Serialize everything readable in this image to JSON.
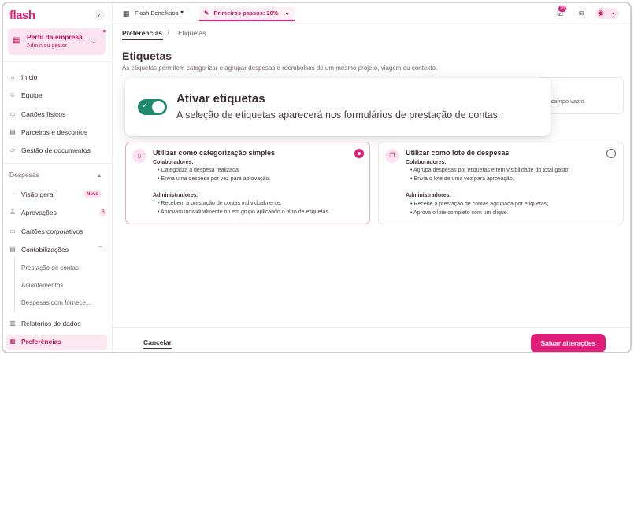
{
  "brand": {
    "logo": "flash",
    "collapse_glyph": "‹"
  },
  "profile": {
    "name": "Perfil da empresa",
    "role": "Admin ou gestor"
  },
  "nav": {
    "main": [
      {
        "label": "Início",
        "icon": "home-icon"
      },
      {
        "label": "Equipe",
        "icon": "users-icon"
      },
      {
        "label": "Cartões físicos",
        "icon": "card-icon"
      },
      {
        "label": "Parceiros e descontos",
        "icon": "store-icon"
      },
      {
        "label": "Gestão de documentos",
        "icon": "folder-icon"
      }
    ],
    "section_label": "Despesas",
    "expenses": [
      {
        "label": "Visão geral",
        "badge": "Novo"
      },
      {
        "label": "Aprovações",
        "badge": "3"
      },
      {
        "label": "Cartões corporativos"
      },
      {
        "label": "Contabilizações"
      }
    ],
    "sub": [
      "Prestação de contas",
      "Adiantamentos",
      "Despesas com fornece..."
    ],
    "bottom": [
      {
        "label": "Relatórios de dados"
      },
      {
        "label": "Preferências"
      }
    ]
  },
  "topbar": {
    "company": "Flash Benefícios",
    "first_steps": "Primeiros passos: 20%",
    "notification_count": "28"
  },
  "breadcrumb": {
    "parent": "Preferências",
    "current": "Etiquetas"
  },
  "page": {
    "title": "Etiquetas",
    "description": "As etiquetas permitem categorizar e agrupar despesas e reembolsos de um mesmo projeto, viagem ou contexto.",
    "behind_text": "m o campo vazio."
  },
  "toggle_card": {
    "title": "Ativar etiquetas",
    "description": "A seleção de etiquetas aparecerá nos formulários de prestação de contas.",
    "enabled": true
  },
  "options": [
    {
      "title": "Utilizar como categorização simples",
      "selected": true,
      "collab_heading": "Colaboradores:",
      "collab_items": [
        "Categoriza a despesa realizada;",
        "Envia uma despesa por vez para aprovação."
      ],
      "admin_heading": "Administradores:",
      "admin_items": [
        "Recebem a prestação de contas individualmente;",
        "Aprovam individualmente ou em grupo aplicando o filtro de etiquetas."
      ]
    },
    {
      "title": "Utilizar como lote de despesas",
      "selected": false,
      "collab_heading": "Colaboradores:",
      "collab_items": [
        "Agrupa despesas por etiquetas e tem visibilidade do total gasto;",
        "Envia o lote de uma vez para aprovação."
      ],
      "admin_heading": "Administradores:",
      "admin_items": [
        "Recebe a prestação de contas agrupada por etiquetas;",
        "Aprova o lote completo com um clique."
      ]
    }
  ],
  "footer": {
    "cancel": "Cancelar",
    "save": "Salvar alterações"
  },
  "colors": {
    "accent": "#e01e7a",
    "toggle_on": "#1d8a6e"
  }
}
